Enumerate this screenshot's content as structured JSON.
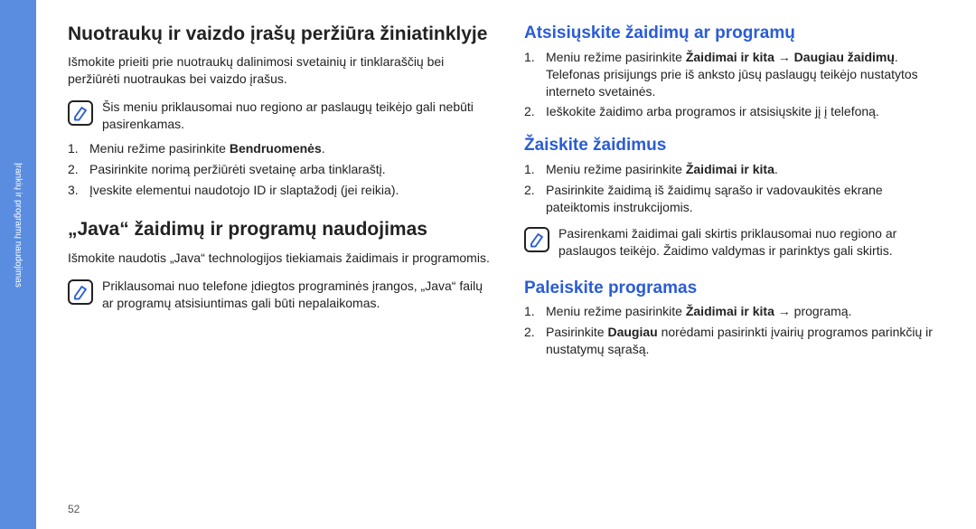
{
  "sidebar": {
    "label": "Įrankių ir programų naudojimas"
  },
  "left": {
    "h1a": "Nuotraukų ir vaizdo įrašų peržiūra žiniatinklyje",
    "p1": "Išmokite prieiti prie nuotraukų dalinimosi svetainių ir tinklaraščių bei peržiūrėti nuotraukas bei vaizdo įrašus.",
    "note1": "Šis meniu priklausomai nuo regiono ar paslaugų teikėjo gali nebūti pasirenkamas.",
    "li1_pre": "Meniu režime pasirinkite ",
    "li1_b": "Bendruomenės",
    "li1_post": ".",
    "li2": "Pasirinkite norimą peržiūrėti svetainę arba tinklaraštį.",
    "li3": "Įveskite elementui naudotojo ID ir slaptažodį (jei reikia).",
    "h1b": "„Java“ žaidimų ir programų naudojimas",
    "p2": "Išmokite naudotis „Java“ technologijos tiekiamais žaidimais ir programomis.",
    "note2": "Priklausomai nuo telefone įdiegtos programinės įrangos, „Java“ failų ar programų atsisiuntimas gali būti nepalaikomas.",
    "page": "52"
  },
  "right": {
    "h2a": "Atsisiųskite žaidimų ar programų",
    "a_li1_pre": "Meniu režime pasirinkite ",
    "a_li1_b1": "Žaidimai ir kita",
    "a_arrow": " → ",
    "a_li1_b2": "Daugiau žaidimų",
    "a_li1_post": ".",
    "a_li1_cont": "Telefonas prisijungs prie iš anksto jūsų paslaugų teikėjo nustatytos interneto svetainės.",
    "a_li2": "Ieškokite žaidimo arba programos ir atsisiųskite jį į telefoną.",
    "h2b": "Žaiskite žaidimus",
    "b_li1_pre": "Meniu režime pasirinkite ",
    "b_li1_b": "Žaidimai ir kita",
    "b_li1_post": ".",
    "b_li2": "Pasirinkite žaidimą iš žaidimų sąrašo ir vadovaukitės ekrane pateiktomis instrukcijomis.",
    "note3": "Pasirenkami žaidimai gali skirtis priklausomai nuo regiono ar paslaugos teikėjo. Žaidimo valdymas ir parinktys gali skirtis.",
    "h2c": "Paleiskite programas",
    "c_li1_pre": "Meniu režime pasirinkite ",
    "c_li1_b": "Žaidimai ir kita",
    "c_li1_post": " → programą.",
    "c_li2_pre": "Pasirinkite ",
    "c_li2_b": "Daugiau",
    "c_li2_post": " norėdami pasirinkti įvairių programos parinkčių ir nustatymų sąrašą."
  }
}
